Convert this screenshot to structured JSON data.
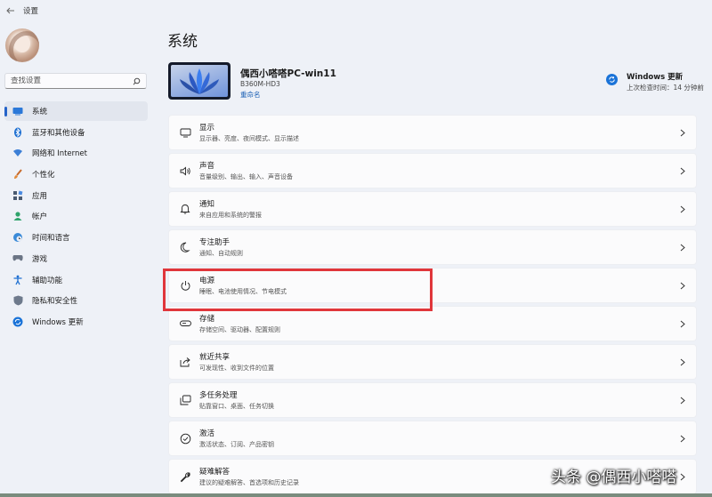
{
  "window": {
    "title": "设置",
    "back_icon": "back-arrow-icon"
  },
  "sidebar": {
    "search_placeholder": "查找设置",
    "items": [
      {
        "label": "系统",
        "icon": "monitor-icon",
        "active": true
      },
      {
        "label": "蓝牙和其他设备",
        "icon": "bluetooth-icon"
      },
      {
        "label": "网络和 Internet",
        "icon": "wifi-icon"
      },
      {
        "label": "个性化",
        "icon": "brush-icon"
      },
      {
        "label": "应用",
        "icon": "apps-icon"
      },
      {
        "label": "帐户",
        "icon": "person-icon"
      },
      {
        "label": "时间和语言",
        "icon": "globe-clock-icon"
      },
      {
        "label": "游戏",
        "icon": "gamepad-icon"
      },
      {
        "label": "辅助功能",
        "icon": "accessibility-icon"
      },
      {
        "label": "隐私和安全性",
        "icon": "shield-icon"
      },
      {
        "label": "Windows 更新",
        "icon": "windows-update-icon"
      }
    ]
  },
  "main": {
    "title": "系统",
    "device": {
      "name": "偶西小嗒嗒PC-win11",
      "model": "B360M-HD3",
      "rename": "重命名"
    },
    "update": {
      "title": "Windows 更新",
      "subtitle": "上次检查时间：14 分钟前"
    },
    "cards": [
      {
        "title": "显示",
        "subtitle": "显示器、亮度、夜间模式、显示描述",
        "icon": "display-icon"
      },
      {
        "title": "声音",
        "subtitle": "音量级别、输出、输入、声音设备",
        "icon": "speaker-icon"
      },
      {
        "title": "通知",
        "subtitle": "来自应用和系统的警报",
        "icon": "bell-icon"
      },
      {
        "title": "专注助手",
        "subtitle": "通知、自动规则",
        "icon": "moon-icon"
      },
      {
        "title": "电源",
        "subtitle": "睡眠、电池使用情况、节电模式",
        "icon": "power-icon"
      },
      {
        "title": "存储",
        "subtitle": "存储空间、驱动器、配置规则",
        "icon": "storage-icon"
      },
      {
        "title": "就近共享",
        "subtitle": "可发现性、收到文件的位置",
        "icon": "share-icon"
      },
      {
        "title": "多任务处理",
        "subtitle": "贴靠窗口、桌面、任务切换",
        "icon": "multitask-icon"
      },
      {
        "title": "激活",
        "subtitle": "激活状态、订阅、产品密钥",
        "icon": "check-circle-icon"
      },
      {
        "title": "疑难解答",
        "subtitle": "建议的疑难解答、首选项和历史记录",
        "icon": "wrench-icon"
      }
    ]
  },
  "watermark": "头条 @偶西小嗒嗒",
  "colors": {
    "accent": "#2563c9",
    "highlight": "#e0363b",
    "background": "#eef1f7",
    "card": "#fbfbfc"
  }
}
